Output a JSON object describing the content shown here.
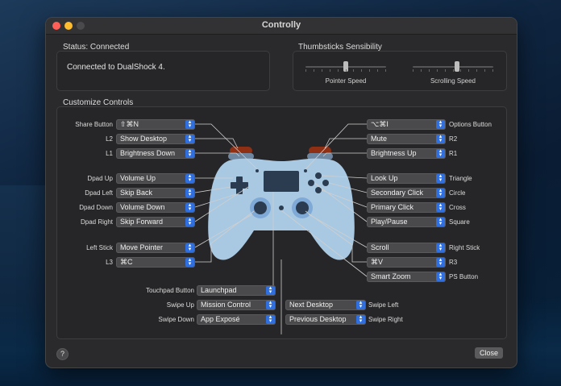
{
  "window": {
    "title": "Controlly"
  },
  "status": {
    "section_title": "Status: Connected",
    "message": "Connected to DualShock 4."
  },
  "thumbsticks": {
    "section_title": "Thumbsticks Sensibility",
    "pointer_speed_label": "Pointer Speed",
    "scrolling_speed_label": "Scrolling Speed",
    "pointer_speed_value": 0.5,
    "scrolling_speed_value": 0.55
  },
  "controls": {
    "section_title": "Customize Controls",
    "left": [
      {
        "label": "Share Button",
        "value": "⇧⌘N"
      },
      {
        "label": "L2",
        "value": "Show Desktop"
      },
      {
        "label": "L1",
        "value": "Brightness Down"
      },
      {
        "label": "Dpad Up",
        "value": "Volume Up"
      },
      {
        "label": "Dpad Left",
        "value": "Skip Back"
      },
      {
        "label": "Dpad Down",
        "value": "Volume Down"
      },
      {
        "label": "Dpad Right",
        "value": "Skip Forward"
      },
      {
        "label": "Left Stick",
        "value": "Move Pointer"
      },
      {
        "label": "L3",
        "value": "⌘C"
      }
    ],
    "right": [
      {
        "label": "Options Button",
        "value": "⌥⌘I"
      },
      {
        "label": "R2",
        "value": "Mute"
      },
      {
        "label": "R1",
        "value": "Brightness Up"
      },
      {
        "label": "Triangle",
        "value": "Look Up"
      },
      {
        "label": "Circle",
        "value": "Secondary Click"
      },
      {
        "label": "Cross",
        "value": "Primary Click"
      },
      {
        "label": "Square",
        "value": "Play/Pause"
      },
      {
        "label": "Right Stick",
        "value": "Scroll"
      },
      {
        "label": "R3",
        "value": "⌘V"
      },
      {
        "label": "PS Button",
        "value": "Smart Zoom"
      }
    ],
    "bottom_left": [
      {
        "label": "Touchpad Button",
        "value": "Launchpad"
      },
      {
        "label": "Swipe Up",
        "value": "Mission Control"
      },
      {
        "label": "Swipe Down",
        "value": "App Exposé"
      }
    ],
    "bottom_right": [
      {
        "label": "Swipe Left",
        "value": "Next Desktop"
      },
      {
        "label": "Swipe Right",
        "value": "Previous Desktop"
      }
    ]
  },
  "footer": {
    "help_label": "?",
    "close_label": "Close"
  },
  "colors": {
    "accent": "#2f6fe0",
    "controller": "#a9c9e3"
  }
}
